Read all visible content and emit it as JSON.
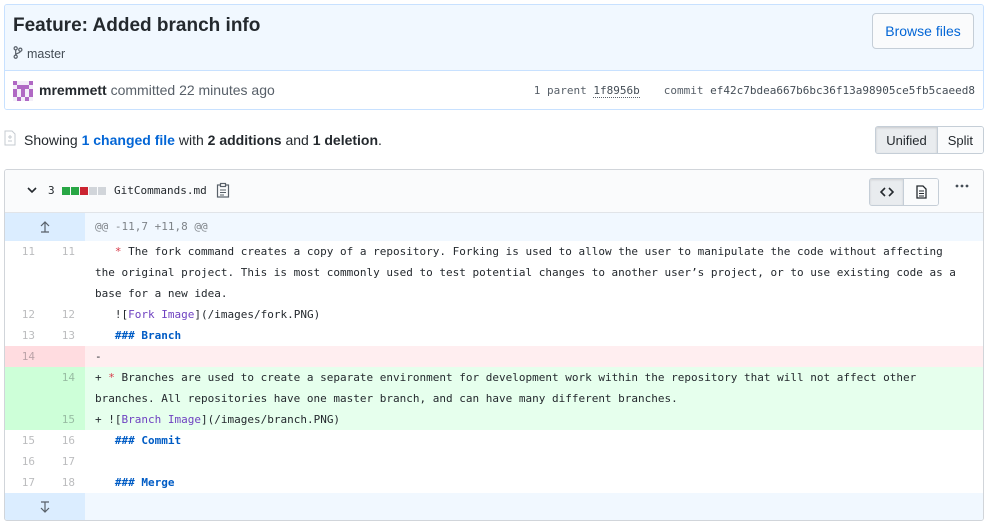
{
  "commit": {
    "title": "Feature: Added branch info",
    "branch": "master",
    "browse_label": "Browse files",
    "author": "mremmett",
    "action": "committed",
    "time": "22 minutes ago",
    "parent_label": "1 parent",
    "parent_sha": "1f8956b",
    "commit_label": "commit",
    "commit_sha": "ef42c7bdea667b6bc36f13a98905ce5fb5caeed8"
  },
  "summary": {
    "showing": "Showing",
    "changed": "1 changed file",
    "with": "with",
    "additions": "2 additions",
    "and": "and",
    "deletions": "1 deletion",
    "period": ".",
    "unified": "Unified",
    "split": "Split"
  },
  "file": {
    "change_count": "3",
    "diffstat": [
      "#28a745",
      "#28a745",
      "#cb2431",
      "#d1d5da",
      "#d1d5da"
    ],
    "name": "GitCommands.md",
    "hunk": "@@ -11,7 +11,8 @@",
    "lines": [
      {
        "type": "ctx",
        "old": "11",
        "new": "11",
        "prefix": " ",
        "parts": [
          [
            "",
            "  "
          ],
          [
            "md-bullet",
            "*"
          ],
          [
            "",
            " The fork command creates a copy of a repository. Forking is used to allow the user to manipulate the code without affecting the original project. This is most commonly used to test potential changes to another user’s project, or to use existing code as a base for a new idea."
          ]
        ]
      },
      {
        "type": "ctx",
        "old": "12",
        "new": "12",
        "prefix": " ",
        "parts": [
          [
            "",
            "  !["
          ],
          [
            "md-alt",
            "Fork Image"
          ],
          [
            "",
            "](/images/fork.PNG)"
          ]
        ]
      },
      {
        "type": "ctx",
        "old": "13",
        "new": "13",
        "prefix": " ",
        "parts": [
          [
            "",
            "  "
          ],
          [
            "md-head",
            "### Branch"
          ]
        ]
      },
      {
        "type": "del",
        "old": "14",
        "new": "",
        "prefix": "-",
        "parts": [
          [
            "",
            ""
          ]
        ]
      },
      {
        "type": "add",
        "old": "",
        "new": "14",
        "prefix": "+",
        "parts": [
          [
            "",
            " "
          ],
          [
            "md-bullet",
            "*"
          ],
          [
            "",
            " Branches are used to create a separate environment for development work within the repository that will not affect other branches. All repositories have one master branch, and can have many different branches."
          ]
        ]
      },
      {
        "type": "add",
        "old": "",
        "new": "15",
        "prefix": "+",
        "parts": [
          [
            "",
            " !["
          ],
          [
            "md-alt",
            "Branch Image"
          ],
          [
            "",
            "](/images/branch.PNG)"
          ]
        ]
      },
      {
        "type": "ctx",
        "old": "15",
        "new": "16",
        "prefix": " ",
        "parts": [
          [
            "",
            "  "
          ],
          [
            "md-head",
            "### Commit"
          ]
        ]
      },
      {
        "type": "ctx",
        "old": "16",
        "new": "17",
        "prefix": " ",
        "parts": [
          [
            "",
            ""
          ]
        ]
      },
      {
        "type": "ctx",
        "old": "17",
        "new": "18",
        "prefix": " ",
        "parts": [
          [
            "",
            "  "
          ],
          [
            "md-head",
            "### Merge"
          ]
        ]
      }
    ]
  }
}
